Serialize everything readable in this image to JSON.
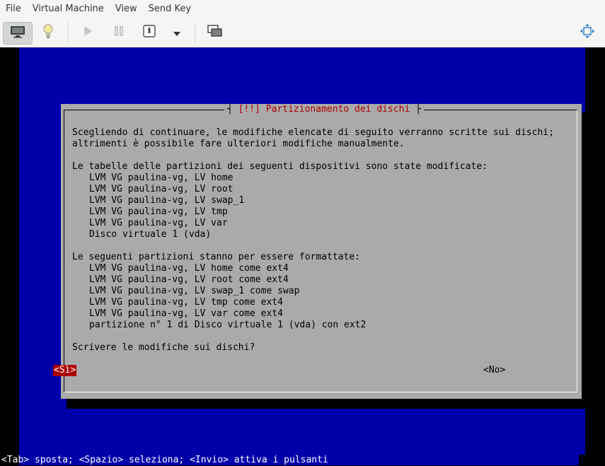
{
  "menubar": {
    "items": [
      {
        "label": "File"
      },
      {
        "label": "Virtual Machine"
      },
      {
        "label": "View"
      },
      {
        "label": "Send Key"
      }
    ]
  },
  "toolbar": {
    "buttons": [
      {
        "icon": "monitor-icon",
        "active": true
      },
      {
        "icon": "lightbulb-icon"
      },
      {
        "icon": "play-icon"
      },
      {
        "icon": "pause-icon"
      },
      {
        "icon": "power-icon"
      },
      {
        "icon": "chevron-down-icon"
      },
      {
        "icon": "screenshot-icon"
      },
      {
        "icon": "fullscreen-icon"
      }
    ]
  },
  "dialog": {
    "title_left": "[!!]",
    "title": "Partizionamento dei dischi",
    "intro": "Scegliendo di continuare, le modifiche elencate di seguito verranno scritte sui dischi;\naltrimenti è possibile fare ulteriori modifiche manualmente.",
    "modified_heading": "Le tabelle delle partizioni dei seguenti dispositivi sono state modificate:",
    "modified": [
      "LVM VG paulina-vg, LV home",
      "LVM VG paulina-vg, LV root",
      "LVM VG paulina-vg, LV swap_1",
      "LVM VG paulina-vg, LV tmp",
      "LVM VG paulina-vg, LV var",
      "Disco virtuale 1 (vda)"
    ],
    "format_heading": "Le seguenti partizioni stanno per essere formattate:",
    "format": [
      "LVM VG paulina-vg, LV home come ext4",
      "LVM VG paulina-vg, LV root come ext4",
      "LVM VG paulina-vg, LV swap_1 come swap",
      "LVM VG paulina-vg, LV tmp come ext4",
      "LVM VG paulina-vg, LV var come ext4",
      "partizione n° 1 di Disco virtuale 1 (vda) con ext2"
    ],
    "question": "Scrivere le modifiche sui dischi?",
    "yes_label": "<Sì>",
    "no_label": "<No>"
  },
  "status_line": "<Tab> sposta; <Spazio> seleziona; <Invio> attiva i pulsanti",
  "colors": {
    "background": "#0000aa",
    "dialog": "#aaaaaa",
    "title": "#aa0000",
    "selected_button": "#aa0000"
  }
}
